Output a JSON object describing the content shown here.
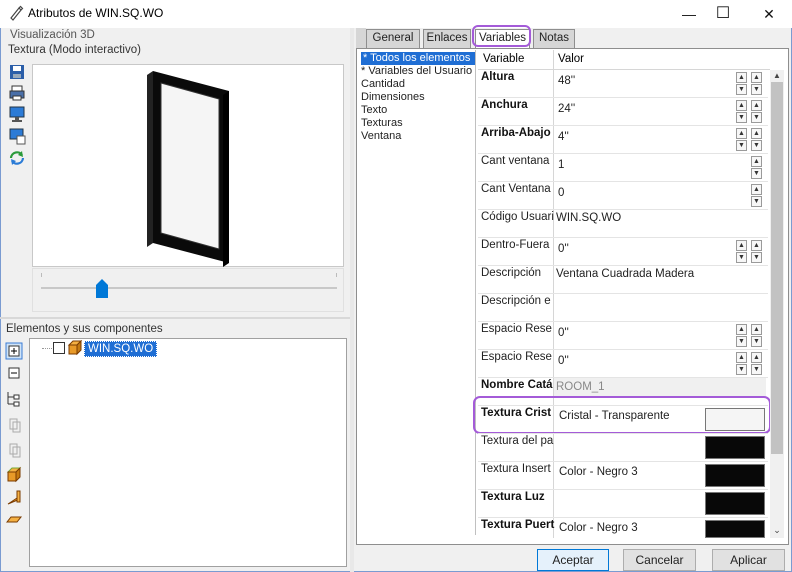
{
  "window": {
    "title": "Atributos de WIN.SQ.WO",
    "minimize": "—",
    "maximize": "☐",
    "close": "✕"
  },
  "left_panel": {
    "viz_label": "Visualización 3D",
    "mode_label": "Textura (Modo interactivo)",
    "elements_label": "Elementos y sus componentes",
    "tree_item": "WIN.SQ.WO"
  },
  "tabs": [
    {
      "label": "General"
    },
    {
      "label": "Enlaces"
    },
    {
      "label": "Variables"
    },
    {
      "label": "Notas"
    }
  ],
  "filters": [
    "* Todos los elementos",
    "* Variables del Usuario",
    "Cantidad",
    "Dimensiones",
    "Texto",
    "Texturas",
    "Ventana"
  ],
  "grid": {
    "col_variable": "Variable",
    "col_value": "Valor",
    "rows": [
      {
        "name": "Altura",
        "value": "48''"
      },
      {
        "name": "Anchura",
        "value": "24''"
      },
      {
        "name": "Arriba-Abajo",
        "value": "4''"
      },
      {
        "name": "Cant ventana",
        "value": "1"
      },
      {
        "name": "Cant Ventana",
        "value": "0"
      },
      {
        "name": "Código Usuari",
        "value": "WIN.SQ.WO"
      },
      {
        "name": "Dentro-Fuera",
        "value": "0''"
      },
      {
        "name": "Descripción",
        "value": "Ventana Cuadrada Madera"
      },
      {
        "name": "Descripción e",
        "value": ""
      },
      {
        "name": "Espacio Rese",
        "value": "0''"
      },
      {
        "name": "Espacio Rese",
        "value": "0''"
      },
      {
        "name": "Nombre Catá",
        "value": "ROOM_1"
      },
      {
        "name": "Textura Crist",
        "value": "Cristal - Transparente"
      },
      {
        "name": "Textura del pa",
        "value": ""
      },
      {
        "name": "Textura Insert",
        "value": "Color - Negro 3"
      },
      {
        "name": "Textura Luz",
        "value": ""
      },
      {
        "name": "Textura Puert",
        "value": "Color - Negro 3"
      }
    ]
  },
  "buttons": {
    "accept": "Aceptar",
    "cancel": "Cancelar",
    "apply": "Aplicar"
  },
  "colors": {
    "accent_highlight": "#a45bd8",
    "selection": "#1f6ed4",
    "swatch_black": "#080808",
    "swatch_glass": "#f5f5f5"
  }
}
